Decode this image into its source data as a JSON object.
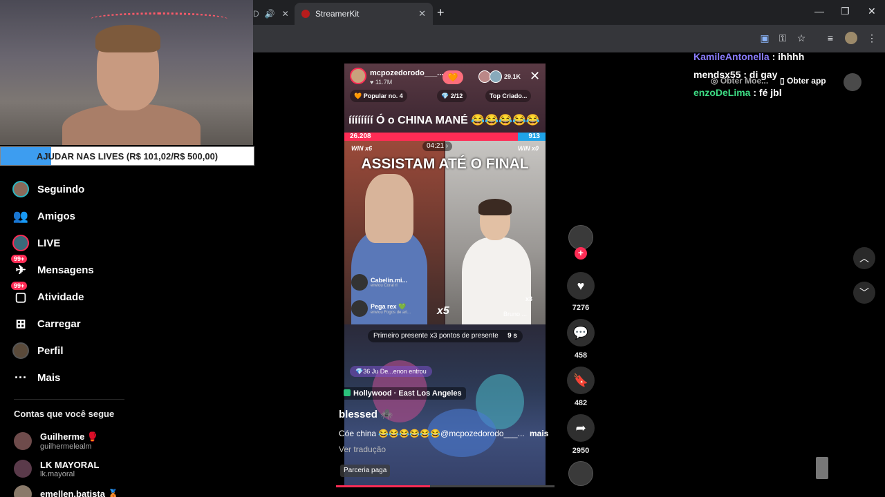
{
  "browser": {
    "inactive_tab_label": "D",
    "active_tab_label": "StreamerKit",
    "tab_close": "✕",
    "new_tab": "+"
  },
  "overlay": {
    "donation_goal": "AJUDAR NAS LIVES (R$ 101,02/R$ 500,00)",
    "donation_progress": 0.2
  },
  "sidebar": {
    "items": [
      {
        "label": "Seguindo",
        "icon": "following-avatar-icon"
      },
      {
        "label": "Amigos",
        "icon": "friends-icon"
      },
      {
        "label": "LIVE",
        "icon": "live-icon"
      },
      {
        "label": "Mensagens",
        "icon": "messages-icon",
        "badge": "99+"
      },
      {
        "label": "Atividade",
        "icon": "activity-icon",
        "badge": "99+"
      },
      {
        "label": "Carregar",
        "icon": "upload-icon"
      },
      {
        "label": "Perfil",
        "icon": "profile-icon"
      },
      {
        "label": "Mais",
        "icon": "more-icon"
      }
    ],
    "following_title": "Contas que você segue",
    "following": [
      {
        "name": "Guilherme 🥊",
        "handle": "guilhermelealm"
      },
      {
        "name": "LK MAYORAL",
        "handle": "lk.mayoral"
      },
      {
        "name": "emellen.batista 🥉",
        "handle": ""
      }
    ]
  },
  "live": {
    "host_name": "mcpozedorodo___...",
    "host_likes": "♥ 11.7M",
    "viewers": "29.1K",
    "popular_rank": "🧡 Popular no. 4",
    "gift_goal": "2/12",
    "top_creators": "Top Criado...",
    "caption": "íííííííí Ó o CHINA MANÉ 😂😂😂😂😂",
    "score_left": "26.208",
    "score_right": "913",
    "win_left": "WIN x6",
    "win_right": "WIN x0",
    "timer": "04:21 ›",
    "banner_text": "ASSISTAM ATÉ O FINAL",
    "gifts": [
      {
        "name": "Cabelin.mi...",
        "sub": "enviou Coral rl"
      },
      {
        "name": "Pega rex 💚",
        "sub": "enviou Fogos de art..."
      }
    ],
    "multiplier_left": "x5",
    "multiplier_right": "x3",
    "opponent": "Bruno ...",
    "gift_banner": "Primeiro presente x3 pontos de presente",
    "gift_banner_seconds": "9 s",
    "entered": "💎36  Ju De...enon  entrou"
  },
  "video": {
    "location": "Hollywood · East Los Angeles",
    "title": "blessed 🕷️",
    "description": "Cóe china 😂😂😂😂😂😂@mcpozedorodo___...",
    "more": "mais",
    "translate": "Ver tradução",
    "paid": "Parceria paga",
    "progress": 0.43
  },
  "actions": {
    "likes": "7276",
    "comments": "458",
    "saves": "482",
    "shares": "2950"
  },
  "topbar": {
    "coins": "Obter Moe...",
    "app": "Obter app"
  },
  "chat": [
    {
      "user": "KamileAntonella",
      "text": " : ihhhh"
    },
    {
      "user": "mendsx55",
      "text": " : di gay"
    },
    {
      "user": "enzoDeLima",
      "text": " : fé jbl"
    }
  ],
  "colors": {
    "accent": "#fe2c55",
    "score_blue": "#1fa3e8"
  }
}
